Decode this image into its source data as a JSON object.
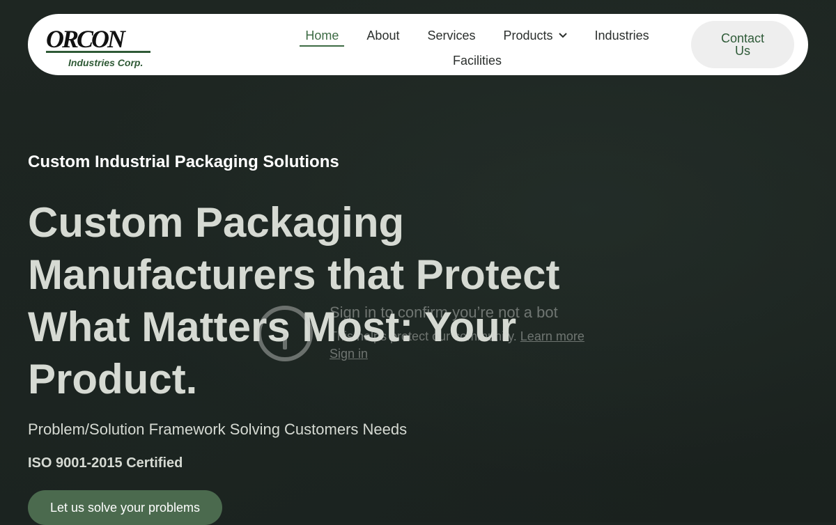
{
  "brand": {
    "logo_main": "ORCON",
    "logo_sub": "Industries Corp.",
    "accent_color": "#3d6b44"
  },
  "nav": {
    "items": [
      {
        "label": "Home",
        "active": true
      },
      {
        "label": "About"
      },
      {
        "label": "Services"
      },
      {
        "label": "Products",
        "icon": "chevron-down-icon"
      },
      {
        "label": "Industries"
      },
      {
        "label": "Facilities"
      }
    ],
    "contact_label": "Contact Us"
  },
  "hero": {
    "eyebrow": "Custom Industrial Packaging Solutions",
    "headline": "Custom Packaging Manufacturers that Protect What Matters Most: Your Product.",
    "subhead": "Problem/Solution Framework Solving Customers Needs",
    "certification": "ISO 9001-2015 Certified",
    "cta_label": "Let us solve your problems"
  },
  "bot_overlay": {
    "title": "Sign in to confirm you’re not a bot",
    "text": "This helps protect our community.",
    "learn_more": "Learn more",
    "sign_in": "Sign in",
    "icon": "alert-circle-icon"
  }
}
